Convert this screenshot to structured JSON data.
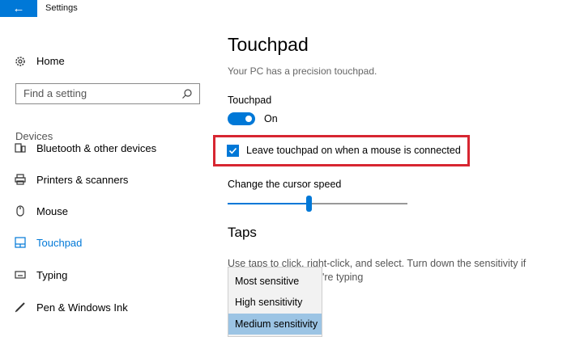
{
  "window": {
    "title": "Settings"
  },
  "sidebar": {
    "home_label": "Home",
    "search_placeholder": "Find a setting",
    "group_label": "Devices",
    "items": [
      {
        "label": "Bluetooth & other devices",
        "icon": "bluetooth-devices-icon"
      },
      {
        "label": "Printers & scanners",
        "icon": "printer-icon"
      },
      {
        "label": "Mouse",
        "icon": "mouse-icon"
      },
      {
        "label": "Touchpad",
        "icon": "touchpad-icon",
        "active": true
      },
      {
        "label": "Typing",
        "icon": "keyboard-icon"
      },
      {
        "label": "Pen & Windows Ink",
        "icon": "pen-icon"
      }
    ]
  },
  "main": {
    "title": "Touchpad",
    "subtitle": "Your PC has a precision touchpad.",
    "touchpad_label": "Touchpad",
    "toggle_state": "On",
    "checkbox_label": "Leave touchpad on when a mouse is connected",
    "checkbox_checked": true,
    "cursor_speed_label": "Change the cursor speed",
    "cursor_speed_fraction": 0.45,
    "taps_title": "Taps",
    "taps_description_line1": "Use taps to click, right-click, and select. Turn down the sensitivity if",
    "taps_description_line2": "'re typing",
    "sensitivity_options": [
      "Most sensitive",
      "High sensitivity",
      "Medium sensitivity"
    ],
    "sensitivity_selected": "Medium sensitivity"
  },
  "colors": {
    "accent": "#0078d7",
    "highlight_border": "#d72631",
    "selected_option": "#9cc4e4"
  }
}
